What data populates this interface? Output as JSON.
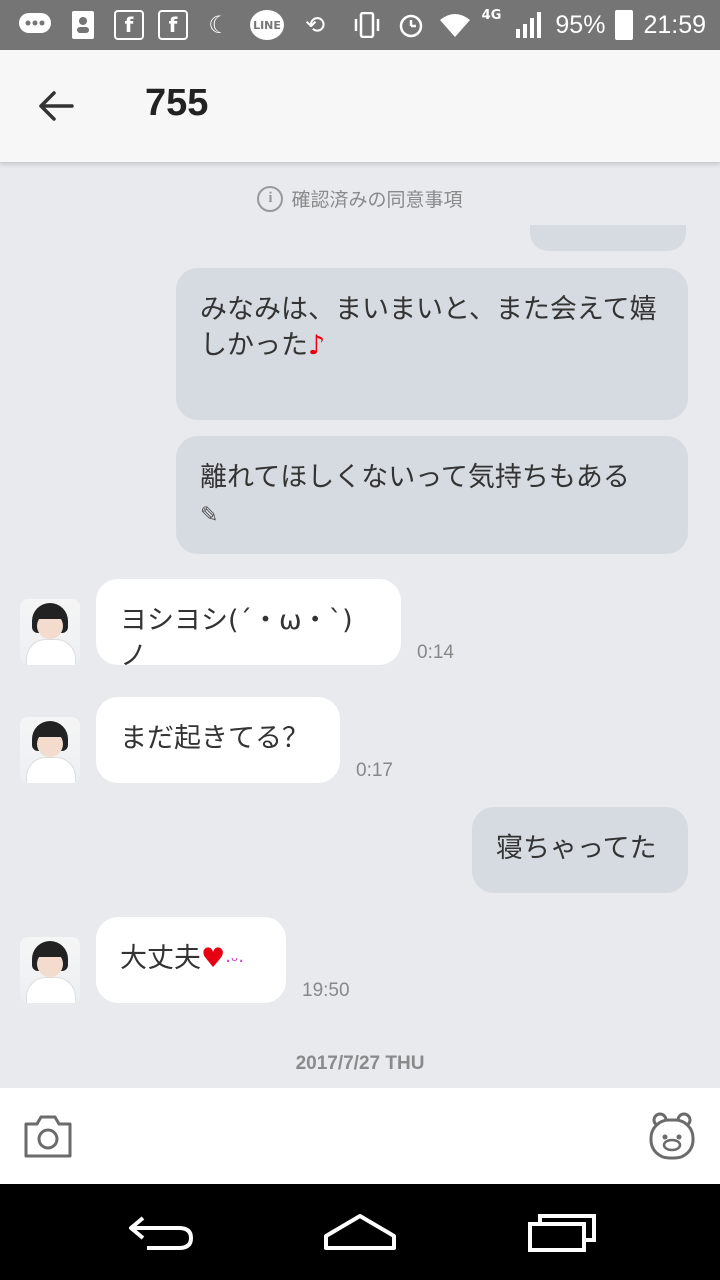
{
  "status_bar": {
    "battery": "95%",
    "time": "21:59",
    "network": "4G",
    "line_label": "LINE",
    "icons": [
      "message-icon",
      "contacts-icon",
      "facebook-icon",
      "facebook-icon",
      "moon-icon",
      "line-icon",
      "rotate-icon",
      "vibrate-icon",
      "alarm-icon",
      "wifi-icon",
      "signal-icon",
      "battery-icon"
    ]
  },
  "header": {
    "title": "755",
    "back_icon": "arrow-left-icon"
  },
  "chat": {
    "notice": "確認済みの同意事項",
    "messages": [
      {
        "side": "out",
        "text": "みなみは、まいまいと、また会えて嬉しかった",
        "emoji": "♪"
      },
      {
        "side": "out",
        "text": "離れてほしくないって気持ちもある",
        "emoji": "✎"
      },
      {
        "side": "in",
        "text": "ヨシヨシ(´・ω・`)ノ",
        "time": "0:14"
      },
      {
        "side": "in",
        "text": "まだ起きてる？",
        "time": "0:17"
      },
      {
        "side": "out",
        "text": "寝ちゃってた"
      },
      {
        "side": "in",
        "text": "大丈夫",
        "emoji": "♥",
        "emoji2": "·ᵕ·",
        "time": "19:50"
      }
    ],
    "date_separator": "2017/7/27 THU"
  },
  "input_bar": {
    "camera_icon": "camera-icon",
    "sticker_icon": "sticker-icon"
  },
  "colors": {
    "status_bar": "#757575",
    "header": "#f7f7f7",
    "chat_bg": "#e8eaed",
    "bubble_out": "#d6dbe1",
    "bubble_in": "#ffffff",
    "accent_red": "#e60012"
  }
}
